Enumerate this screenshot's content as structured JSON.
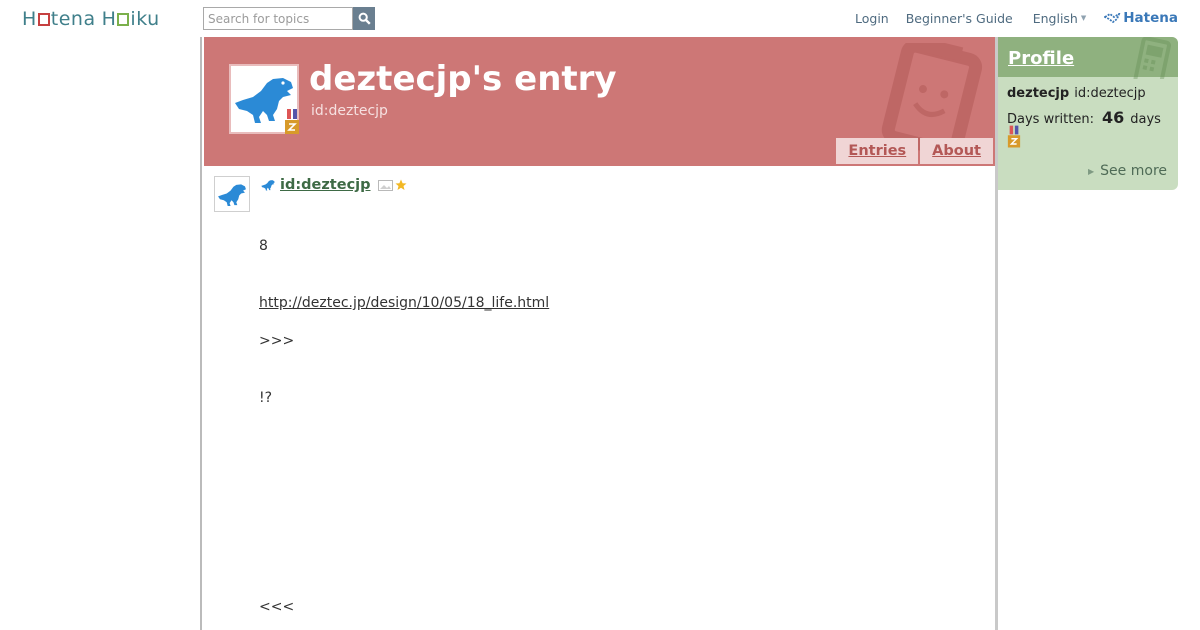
{
  "header": {
    "logo_text": "Hatena Haiku",
    "search_placeholder": "Search for topics",
    "nav": {
      "login": "Login",
      "guide": "Beginner's Guide",
      "language": "English",
      "hatena": "Hatena"
    }
  },
  "banner": {
    "title": "deztecjp's entry",
    "user_id": "id:deztecjp",
    "tabs": [
      "Entries",
      "About"
    ]
  },
  "entry": {
    "user_link": "id:deztecjp",
    "lines": [
      "8",
      "http://deztec.jp/design/10/05/18_life.html",
      ">>>",
      "!?",
      "<<<"
    ]
  },
  "profile": {
    "heading": "Profile",
    "name": "deztecjp",
    "id": "id:deztecjp",
    "days_label": "Days written:",
    "days_count": "46",
    "days_unit": "days",
    "see_more": "See more"
  },
  "colors": {
    "banner_bg": "#cd7776",
    "profile_bg": "#c9ddc0",
    "profile_head": "#8fb17f",
    "link_blue": "#4f6b80"
  }
}
